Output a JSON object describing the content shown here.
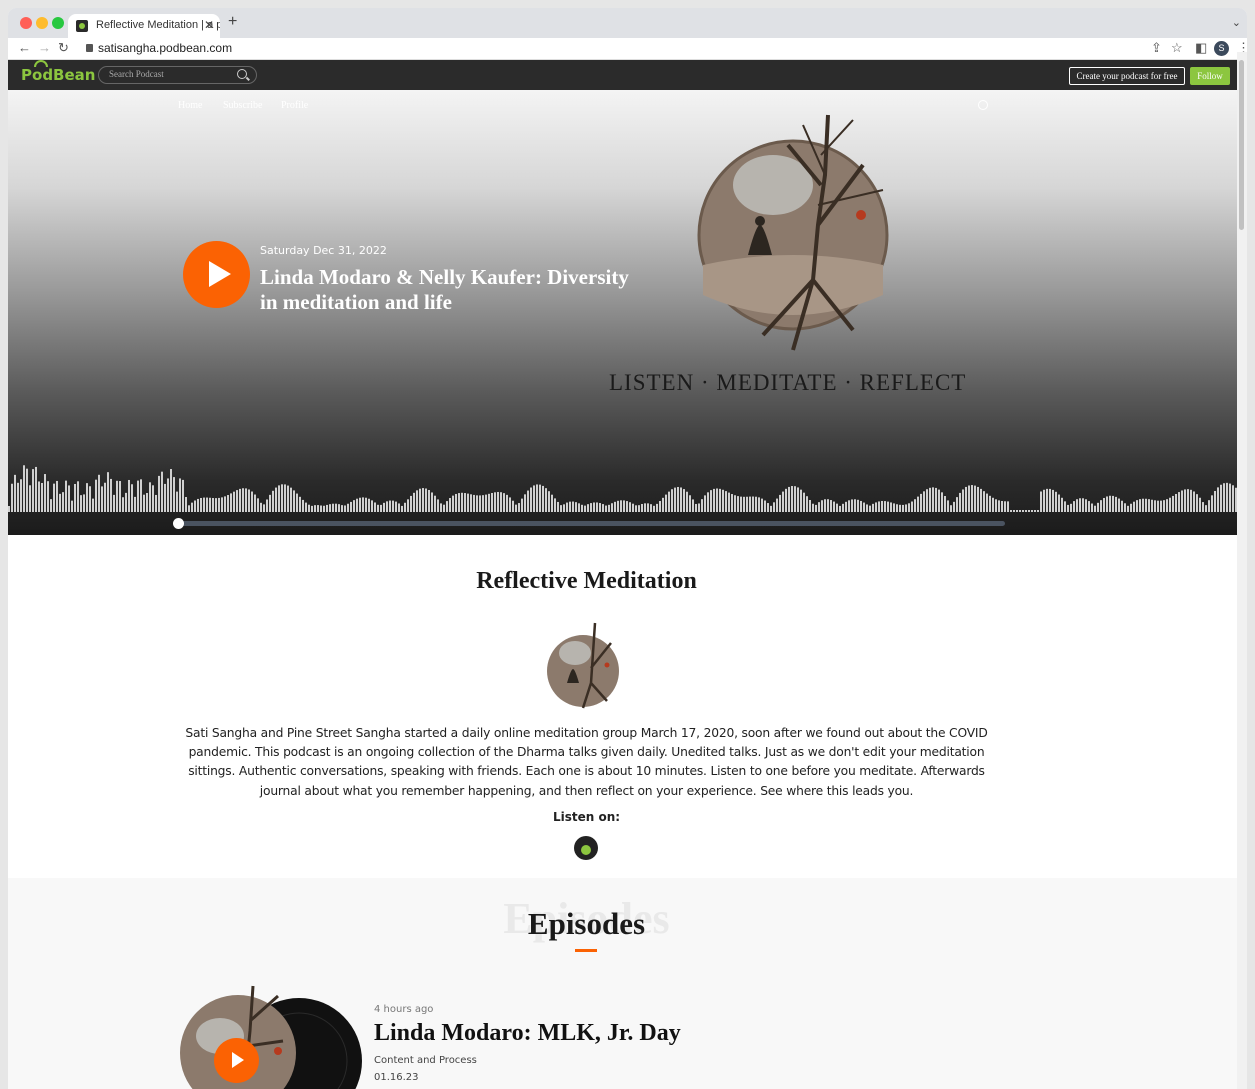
{
  "browser": {
    "tab_title": "Reflective Meditation | a podca",
    "url": "satisangha.podbean.com",
    "profile_initial": "S",
    "colors": {
      "close": "#ff5f57",
      "minimize": "#febc2e",
      "maximize": "#28c840"
    }
  },
  "podbean": {
    "logo": "PodBean",
    "search_placeholder": "Search Podcast",
    "create_label": "Create your podcast for free",
    "follow_label": "Follow",
    "accent": "#8cc63f"
  },
  "hero": {
    "nav": [
      "Home",
      "Subscribe",
      "Profile"
    ],
    "date": "Saturday Dec 31, 2022",
    "title": "Linda Modaro & Nelly Kaufer: Diversity in meditation and life",
    "tagline": "LISTEN · MEDITATE · REFLECT",
    "play_color": "#fb6203",
    "progress": 0.0
  },
  "podcast": {
    "title": "Reflective Meditation",
    "description": "Sati Sangha and Pine Street Sangha started a daily online meditation group March 17, 2020, soon after we found out about the COVID pandemic. This podcast is an ongoing collection of the Dharma talks given daily. Unedited talks. Just as we don't edit your meditation sittings. Authentic conversations, speaking with friends. Each one is about 10 minutes. Listen to one before you meditate. Afterwards journal about what you remember happening, and then reflect on your experience. See where this leads you.",
    "listen_on": "Listen on:"
  },
  "episodes": {
    "ghost": "Episodes",
    "heading": "Episodes",
    "items": [
      {
        "ago": "4 hours ago",
        "title": "Linda Modaro: MLK, Jr. Day",
        "category": "Content and Process",
        "date": "01.16.23"
      }
    ]
  }
}
